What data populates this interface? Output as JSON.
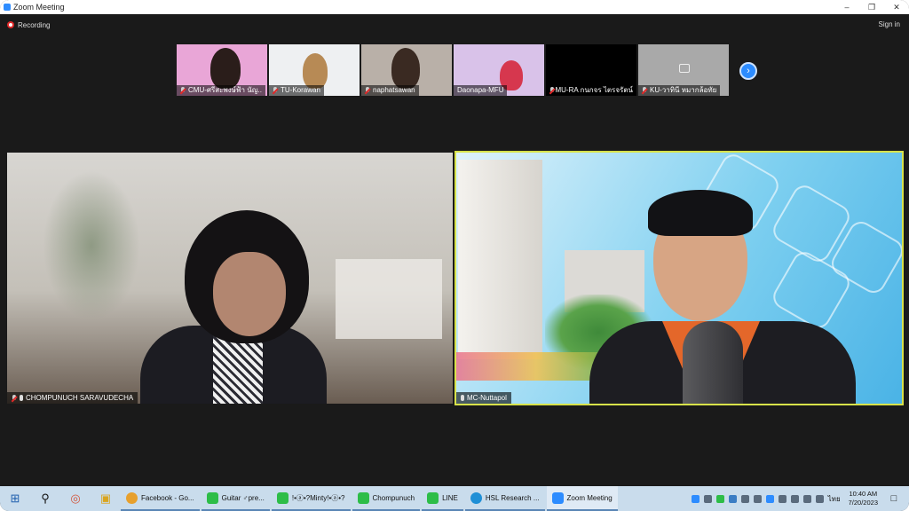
{
  "window": {
    "title": "Zoom Meeting"
  },
  "zoombar": {
    "recording": "Recording",
    "sign_in": "Sign in"
  },
  "thumbnails": [
    {
      "name": "CMU-ศรีสะพงษ์ฟ้า นัญ..",
      "bg": "#e9a6d7"
    },
    {
      "name": "TU-Korawan",
      "bg": "#eef0f2"
    },
    {
      "name": "naphatsawan",
      "bg": "#b9b0a8"
    },
    {
      "name": "Daonapa-MFU",
      "bg": "#d9c2e9"
    },
    {
      "name": "MU-RA กนกจร ไตรจรัตน์",
      "bg": "#000000"
    },
    {
      "name": "KU-วาทินี หมากล้อทัย",
      "bg": "#a9a9a9"
    }
  ],
  "main_tiles": {
    "left": {
      "name": "CHOMPUNUCH SARAVUDECHA"
    },
    "right": {
      "name": "MC-Nuttapol"
    }
  },
  "taskbar": {
    "apps": [
      {
        "label": "Facebook - Go...",
        "color": "#e7a02d"
      },
      {
        "label": "Guitar ♂pre...",
        "color": "#2dbd48"
      },
      {
        "label": "!•ⓐ•?Minty!•ⓐ•?",
        "color": "#2dbd48"
      },
      {
        "label": "Chompunuch",
        "color": "#2dbd48"
      },
      {
        "label": "LINE",
        "color": "#2dbd48"
      },
      {
        "label": "HSL Research ...",
        "color": "#1f8fd6"
      },
      {
        "label": "Zoom Meeting",
        "color": "#2d8cff"
      }
    ],
    "lang": "ไทย",
    "time": "10:40 AM",
    "date": "7/20/2023"
  },
  "colors": {
    "accent": "#2d8cff",
    "active_speaker_border": "#d8e24a",
    "recording": "#e02828"
  }
}
